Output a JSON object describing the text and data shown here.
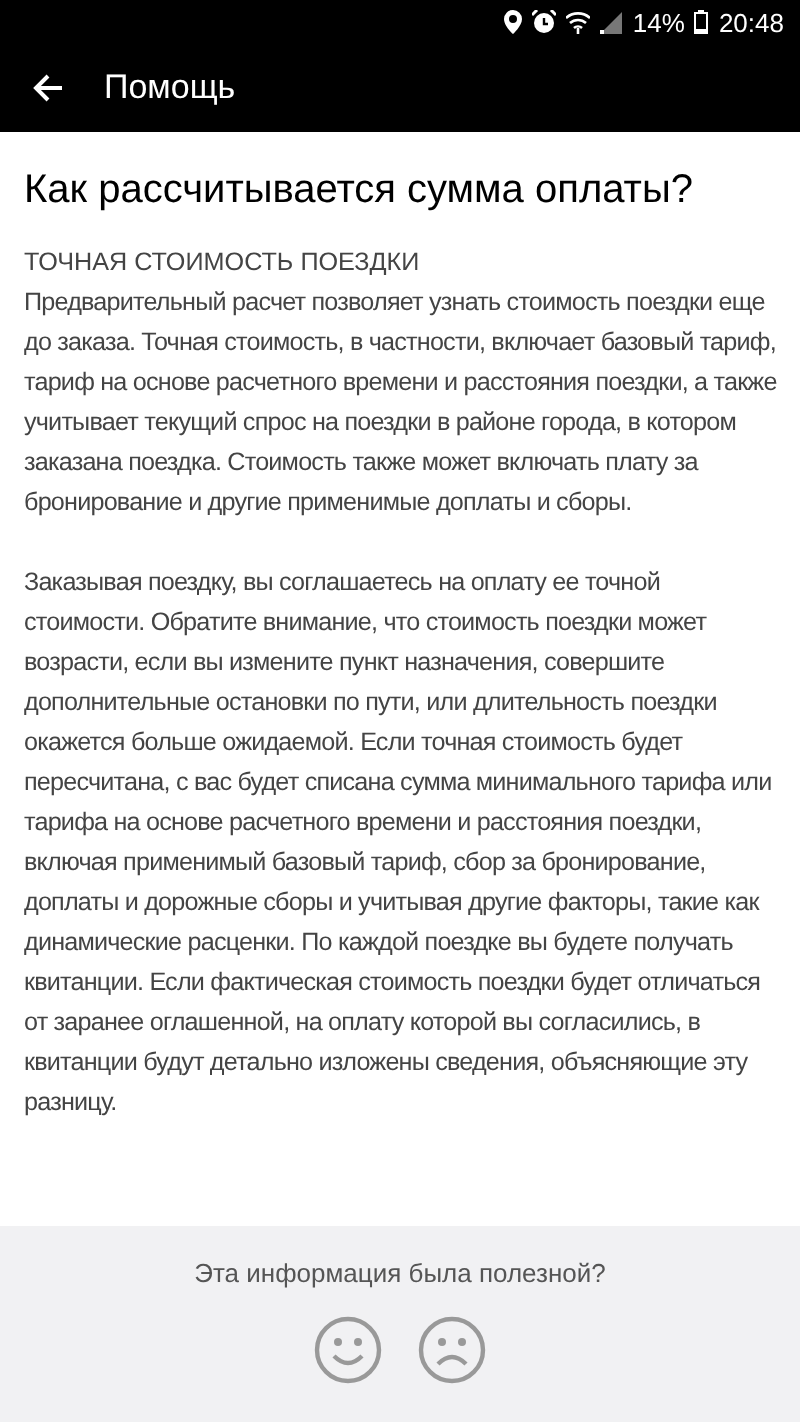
{
  "status_bar": {
    "battery": "14%",
    "time": "20:48"
  },
  "app_bar": {
    "title": "Помощь"
  },
  "article": {
    "title": "Как рассчитывается сумма оплаты?",
    "section_heading": "ТОЧНАЯ СТОИМОСТЬ ПОЕЗДКИ",
    "paragraphs": [
      "Предварительный расчет позволяет узнать стоимость поездки еще до заказа. Точная стоимость, в частности, включает базовый тариф, тариф на основе расчетного времени и расстояния поездки, а также учитывает текущий спрос на поездки в районе города, в котором заказана поездка. Стоимость также может включать плату за бронирование и другие применимые доплаты и сборы.",
      "Заказывая поездку, вы соглашаетесь на оплату ее точной стоимости. Обратите внимание, что стоимость поездки может возрасти, если вы измените пункт назначения, совершите дополнительные остановки по пути, или длительность поездки окажется больше ожидаемой. Если точная стоимость будет пересчитана, с вас будет списана сумма минимального тарифа или тарифа на основе расчетного времени и расстояния поездки, включая применимый базовый тариф, сбор за бронирование, доплаты и дорожные сборы и учитывая другие факторы, такие как динамические расценки. По каждой поездке вы будете получать квитанции. Если фактическая стоимость поездки будет отличаться от заранее оглашенной, на оплату которой вы согласились, в квитанции будут детально изложены сведения, объясняющие эту разницу."
    ]
  },
  "feedback": {
    "question": "Эта информация была полезной?",
    "options": [
      {
        "kind": "happy"
      },
      {
        "kind": "sad"
      }
    ]
  }
}
